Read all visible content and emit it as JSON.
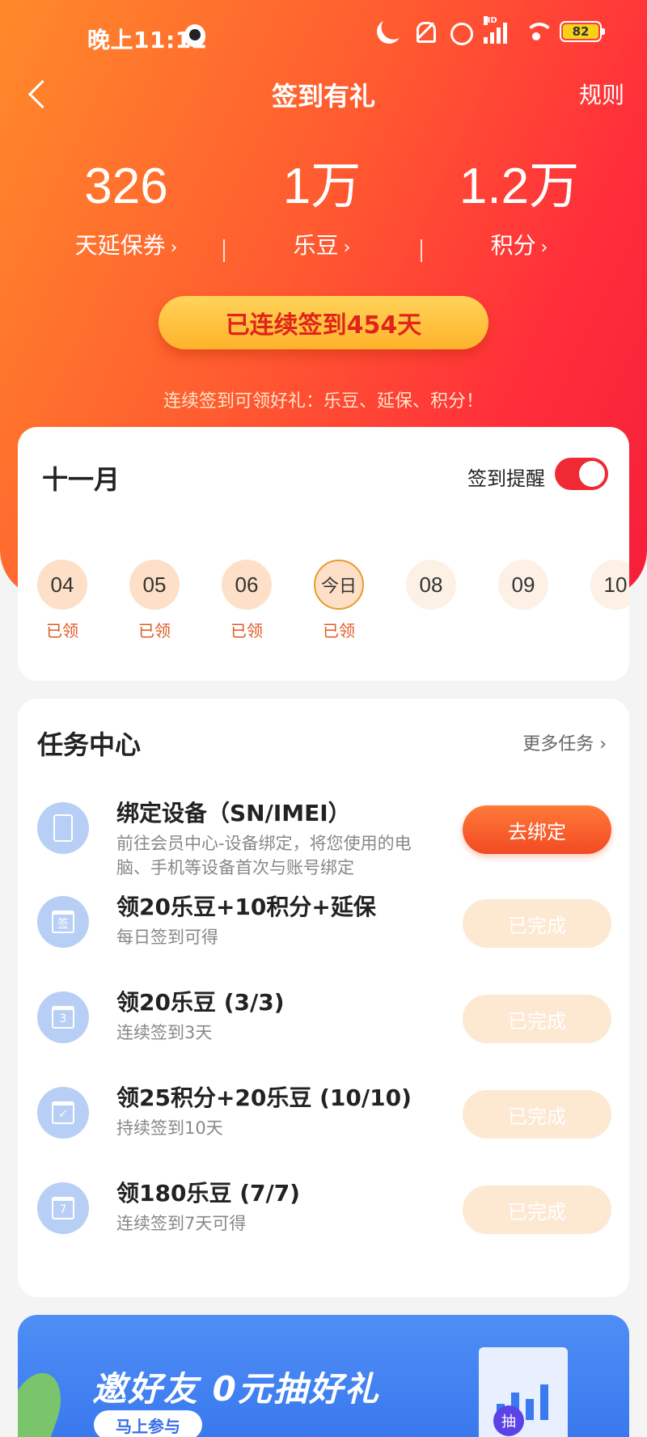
{
  "status_bar": {
    "time": "晚上11:12",
    "hd": "HD",
    "battery": "82"
  },
  "nav": {
    "title": "签到有礼",
    "rule": "规则"
  },
  "stats": [
    {
      "value": "326",
      "label": "天延保券"
    },
    {
      "value": "1万",
      "label": "乐豆"
    },
    {
      "value": "1.2万",
      "label": "积分"
    }
  ],
  "chevron": "›",
  "streak": "已连续签到454天",
  "hero_tip": "连续签到可领好礼：乐豆、延保、积分！",
  "calendar": {
    "month": "十一月",
    "remind_label": "签到提醒",
    "remind_on": true,
    "days": [
      {
        "label": "04",
        "status": "已领"
      },
      {
        "label": "05",
        "status": "已领"
      },
      {
        "label": "06",
        "status": "已领"
      },
      {
        "label": "今日",
        "status": "已领"
      },
      {
        "label": "08",
        "status": ""
      },
      {
        "label": "09",
        "status": ""
      },
      {
        "label": "10",
        "status": ""
      }
    ]
  },
  "tasks": {
    "title": "任务中心",
    "more": "更多任务 ›",
    "items": [
      {
        "name": "绑定设备（SN/IMEI）",
        "desc": "前往会员中心-设备绑定，将您使用的电脑、手机等设备首次与账号绑定",
        "button": "去绑定",
        "icon": "phone-icon",
        "glyph": ""
      },
      {
        "name": "领20乐豆+10积分+延保",
        "desc": "每日签到可得",
        "button": "已完成",
        "icon": "calendar-sign-icon",
        "glyph": "签"
      },
      {
        "name": "领20乐豆 (3/3)",
        "desc": "连续签到3天",
        "button": "已完成",
        "icon": "calendar-3-icon",
        "glyph": "3"
      },
      {
        "name": "领25积分+20乐豆 (10/10)",
        "desc": "持续签到10天",
        "button": "已完成",
        "icon": "calendar-check-icon",
        "glyph": "✓"
      },
      {
        "name": "领180乐豆 (7/7)",
        "desc": "连续签到7天可得",
        "button": "已完成",
        "icon": "calendar-7-icon",
        "glyph": "7"
      }
    ]
  },
  "banner": {
    "title": "邀好友 0元抽好礼",
    "button": "马上参与",
    "coin": "抽"
  },
  "colors": {
    "accent": "#ff2f3a",
    "streak_text": "#e0251b",
    "done_button": "#fde8d2"
  }
}
